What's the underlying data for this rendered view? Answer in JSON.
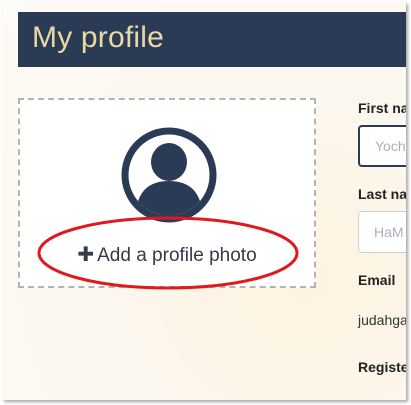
{
  "header": {
    "title": "My profile"
  },
  "photo": {
    "add_label": "Add a profile photo",
    "avatar_icon": "user-circle-icon",
    "plus_icon": "plus-icon"
  },
  "form": {
    "first_name_label": "First na",
    "first_name_placeholder": "Yoch",
    "last_name_label": "Last nar",
    "last_name_placeholder": "HaM",
    "email_label": "Email",
    "email_value": "judahga",
    "registered_label": "Registe"
  },
  "colors": {
    "header_bg": "#2b3a55",
    "header_text": "#e9d9a6",
    "highlight": "#e0191f"
  }
}
